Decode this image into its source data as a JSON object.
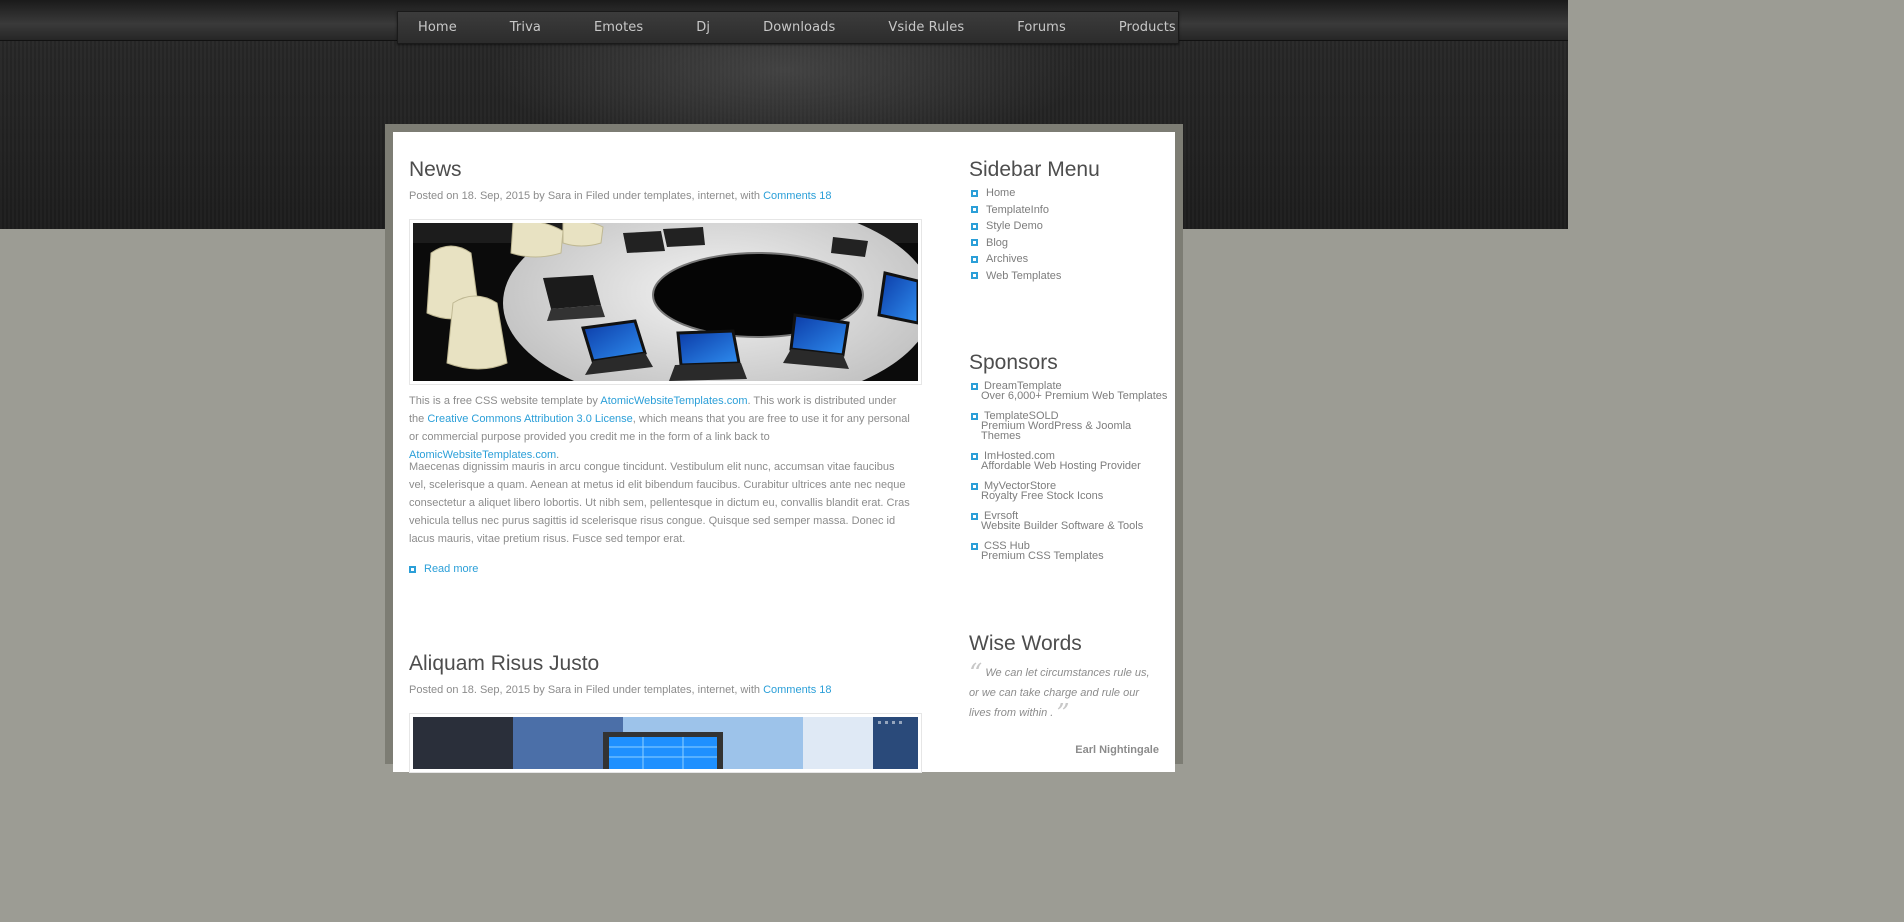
{
  "nav": [
    "Home",
    "Triva",
    "Emotes",
    "Dj",
    "Downloads",
    "Vside Rules",
    "Forums",
    "Products"
  ],
  "posts": [
    {
      "title": "News",
      "meta_prefix": "Posted on 18. Sep, 2015 by Sara in Filed under templates, internet, with",
      "comments": "Comments 18",
      "p1": {
        "a": "This is a free CSS website template by",
        "link1": "AtomicWebsiteTemplates.com",
        "b": ". This work is distributed under the",
        "link2": "Creative Commons Attribution 3.0 License",
        "c": ", which means that you are free to use it for any personal or commercial purpose provided you credit me in the form of a link back to",
        "link3": "AtomicWebsiteTemplates.com",
        "d": "."
      },
      "p2": "Maecenas dignissim mauris in arcu congue tincidunt. Vestibulum elit nunc, accumsan vitae faucibus vel, scelerisque a quam. Aenean at metus id elit bibendum faucibus. Curabitur ultrices ante nec neque consectetur a aliquet libero lobortis. Ut nibh sem, pellentesque in dictum eu, convallis blandit erat. Cras vehicula tellus nec purus sagittis id scelerisque risus congue. Quisque sed semper massa. Donec id lacus mauris, vitae pretium risus. Fusce sed tempor erat.",
      "read_more": "Read more"
    },
    {
      "title": "Aliquam Risus Justo",
      "meta_prefix": "Posted on 18. Sep, 2015 by Sara in Filed under templates, internet, with",
      "comments": "Comments 18"
    }
  ],
  "sidebar": {
    "menu_title": "Sidebar Menu",
    "menu": [
      "Home",
      "TemplateInfo",
      "Style Demo",
      "Blog",
      "Archives",
      "Web Templates"
    ],
    "sponsors_title": "Sponsors",
    "sponsors": [
      {
        "name": "DreamTemplate",
        "desc": "Over 6,000+ Premium Web Templates"
      },
      {
        "name": "TemplateSOLD",
        "desc": "Premium WordPress & Joomla Themes"
      },
      {
        "name": "ImHosted.com",
        "desc": "Affordable Web Hosting Provider"
      },
      {
        "name": "MyVectorStore",
        "desc": "Royalty Free Stock Icons"
      },
      {
        "name": "Evrsoft",
        "desc": "Website Builder Software & Tools"
      },
      {
        "name": "CSS Hub",
        "desc": "Premium CSS Templates"
      }
    ],
    "wise_title": "Wise Words",
    "quote": "We can let circumstances rule us, or we can take charge and rule our lives from within .",
    "author": "Earl Nightingale"
  },
  "colors": {
    "accent": "#2b9fd8",
    "heading": "#4d4d4d",
    "text": "#8c8c8c"
  }
}
